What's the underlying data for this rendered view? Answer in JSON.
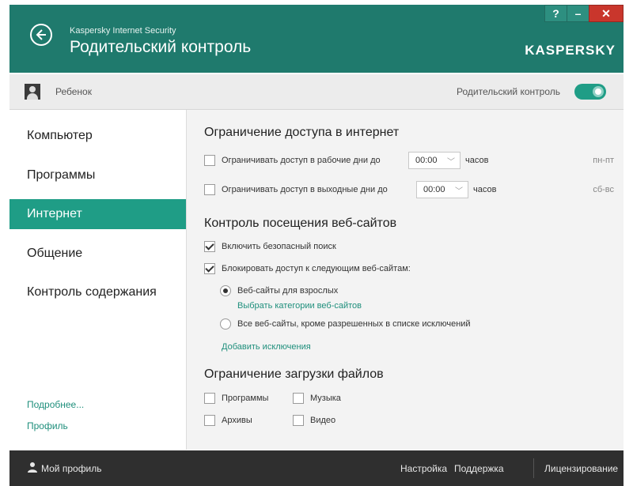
{
  "window": {
    "app_name": "Kaspersky Internet Security",
    "title": "Родительский контроль",
    "help_label": "?",
    "minimize_label": "–",
    "close_label": "✕",
    "brand": "KASPERSKY"
  },
  "profile": {
    "child_name": "Ребенок",
    "parental_control_label": "Родительский контроль",
    "parental_control_enabled": true
  },
  "sidebar": {
    "items": [
      {
        "label": "Компьютер",
        "active": false
      },
      {
        "label": "Программы",
        "active": false
      },
      {
        "label": "Интернет",
        "active": true
      },
      {
        "label": "Общение",
        "active": false
      },
      {
        "label": "Контроль содержания",
        "active": false
      }
    ],
    "more_link": "Подробнее...",
    "profile_link": "Профиль"
  },
  "internet_access": {
    "title": "Ограничение доступа в интернет",
    "weekdays": {
      "label": "Ограничивать доступ в рабочие дни до",
      "time": "00:00",
      "unit": "часов",
      "days": "пн-пт",
      "checked": false
    },
    "weekends": {
      "label": "Ограничивать доступ в выходные дни до",
      "time": "00:00",
      "unit": "часов",
      "days": "сб-вс",
      "checked": false
    }
  },
  "web_control": {
    "title": "Контроль посещения веб-сайтов",
    "safe_search": {
      "label": "Включить безопасный поиск",
      "checked": true
    },
    "block_sites": {
      "label": "Блокировать доступ к следующим веб-сайтам:",
      "checked": true
    },
    "adult_sites": {
      "label": "Веб-сайты для взрослых",
      "selected": true
    },
    "choose_categories": "Выбрать категории веб-сайтов",
    "all_sites": {
      "label": "Все веб-сайты, кроме разрешенных в списке исключений",
      "selected": false
    },
    "add_exceptions": "Добавить исключения"
  },
  "downloads": {
    "title": "Ограничение загрузки файлов",
    "programs": {
      "label": "Программы",
      "checked": false
    },
    "music": {
      "label": "Музыка",
      "checked": false
    },
    "archives": {
      "label": "Архивы",
      "checked": false
    },
    "video": {
      "label": "Видео",
      "checked": false
    }
  },
  "footer": {
    "my_profile": "Мой профиль",
    "settings": "Настройка",
    "support": "Поддержка",
    "licensing": "Лицензирование"
  },
  "colors": {
    "accent": "#1f9d86",
    "title_bar": "#1f7a6d",
    "footer": "#2f2f2f",
    "close": "#c9362c"
  }
}
